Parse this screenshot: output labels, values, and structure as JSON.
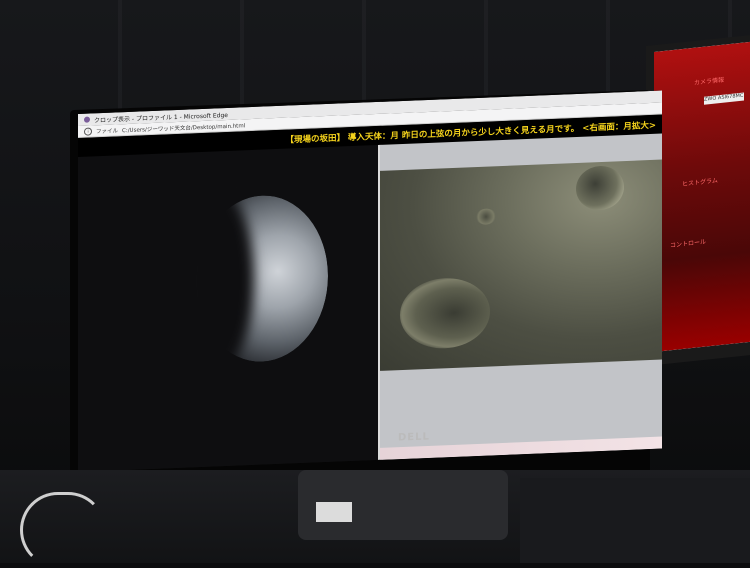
{
  "browser": {
    "title": "クロップ表示 - プロファイル 1 - Microsoft Edge",
    "address_label": "ファイル",
    "address_path": "C:/Users/ジーワッド天文台/Desktop/main.html"
  },
  "banner": {
    "text": "【現場の坂田】 導入天体：月  昨日の上弦の月から少し大きく見える月です。 <右画面：月拡大>"
  },
  "stand": {
    "brand": "DELL"
  },
  "side_monitor": {
    "labels": [
      "カメラ情報",
      "ZWO ASI678MC",
      "ヒストグラム",
      "コントロール"
    ]
  },
  "colors": {
    "banner_text": "#f5d31c",
    "side_accent": "#b01010"
  }
}
